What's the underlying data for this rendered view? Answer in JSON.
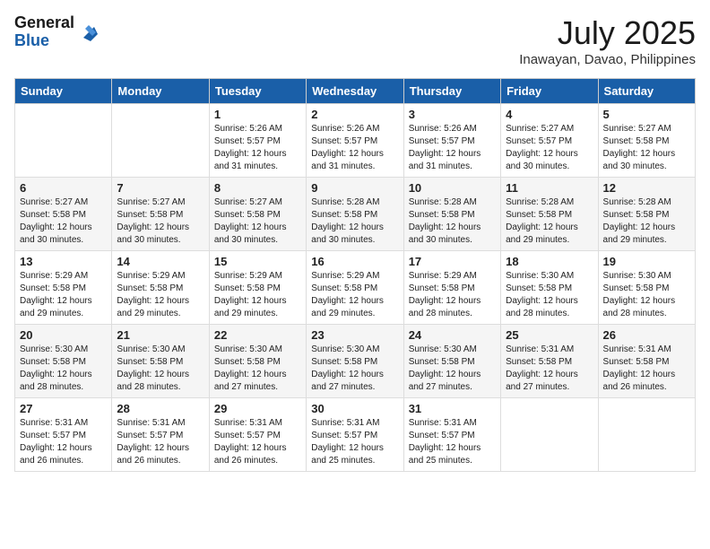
{
  "logo": {
    "general": "General",
    "blue": "Blue"
  },
  "title": "July 2025",
  "location": "Inawayan, Davao, Philippines",
  "weekdays": [
    "Sunday",
    "Monday",
    "Tuesday",
    "Wednesday",
    "Thursday",
    "Friday",
    "Saturday"
  ],
  "weeks": [
    [
      {
        "day": "",
        "info": ""
      },
      {
        "day": "",
        "info": ""
      },
      {
        "day": "1",
        "info": "Sunrise: 5:26 AM\nSunset: 5:57 PM\nDaylight: 12 hours and 31 minutes."
      },
      {
        "day": "2",
        "info": "Sunrise: 5:26 AM\nSunset: 5:57 PM\nDaylight: 12 hours and 31 minutes."
      },
      {
        "day": "3",
        "info": "Sunrise: 5:26 AM\nSunset: 5:57 PM\nDaylight: 12 hours and 31 minutes."
      },
      {
        "day": "4",
        "info": "Sunrise: 5:27 AM\nSunset: 5:57 PM\nDaylight: 12 hours and 30 minutes."
      },
      {
        "day": "5",
        "info": "Sunrise: 5:27 AM\nSunset: 5:58 PM\nDaylight: 12 hours and 30 minutes."
      }
    ],
    [
      {
        "day": "6",
        "info": "Sunrise: 5:27 AM\nSunset: 5:58 PM\nDaylight: 12 hours and 30 minutes."
      },
      {
        "day": "7",
        "info": "Sunrise: 5:27 AM\nSunset: 5:58 PM\nDaylight: 12 hours and 30 minutes."
      },
      {
        "day": "8",
        "info": "Sunrise: 5:27 AM\nSunset: 5:58 PM\nDaylight: 12 hours and 30 minutes."
      },
      {
        "day": "9",
        "info": "Sunrise: 5:28 AM\nSunset: 5:58 PM\nDaylight: 12 hours and 30 minutes."
      },
      {
        "day": "10",
        "info": "Sunrise: 5:28 AM\nSunset: 5:58 PM\nDaylight: 12 hours and 30 minutes."
      },
      {
        "day": "11",
        "info": "Sunrise: 5:28 AM\nSunset: 5:58 PM\nDaylight: 12 hours and 29 minutes."
      },
      {
        "day": "12",
        "info": "Sunrise: 5:28 AM\nSunset: 5:58 PM\nDaylight: 12 hours and 29 minutes."
      }
    ],
    [
      {
        "day": "13",
        "info": "Sunrise: 5:29 AM\nSunset: 5:58 PM\nDaylight: 12 hours and 29 minutes."
      },
      {
        "day": "14",
        "info": "Sunrise: 5:29 AM\nSunset: 5:58 PM\nDaylight: 12 hours and 29 minutes."
      },
      {
        "day": "15",
        "info": "Sunrise: 5:29 AM\nSunset: 5:58 PM\nDaylight: 12 hours and 29 minutes."
      },
      {
        "day": "16",
        "info": "Sunrise: 5:29 AM\nSunset: 5:58 PM\nDaylight: 12 hours and 29 minutes."
      },
      {
        "day": "17",
        "info": "Sunrise: 5:29 AM\nSunset: 5:58 PM\nDaylight: 12 hours and 28 minutes."
      },
      {
        "day": "18",
        "info": "Sunrise: 5:30 AM\nSunset: 5:58 PM\nDaylight: 12 hours and 28 minutes."
      },
      {
        "day": "19",
        "info": "Sunrise: 5:30 AM\nSunset: 5:58 PM\nDaylight: 12 hours and 28 minutes."
      }
    ],
    [
      {
        "day": "20",
        "info": "Sunrise: 5:30 AM\nSunset: 5:58 PM\nDaylight: 12 hours and 28 minutes."
      },
      {
        "day": "21",
        "info": "Sunrise: 5:30 AM\nSunset: 5:58 PM\nDaylight: 12 hours and 28 minutes."
      },
      {
        "day": "22",
        "info": "Sunrise: 5:30 AM\nSunset: 5:58 PM\nDaylight: 12 hours and 27 minutes."
      },
      {
        "day": "23",
        "info": "Sunrise: 5:30 AM\nSunset: 5:58 PM\nDaylight: 12 hours and 27 minutes."
      },
      {
        "day": "24",
        "info": "Sunrise: 5:30 AM\nSunset: 5:58 PM\nDaylight: 12 hours and 27 minutes."
      },
      {
        "day": "25",
        "info": "Sunrise: 5:31 AM\nSunset: 5:58 PM\nDaylight: 12 hours and 27 minutes."
      },
      {
        "day": "26",
        "info": "Sunrise: 5:31 AM\nSunset: 5:58 PM\nDaylight: 12 hours and 26 minutes."
      }
    ],
    [
      {
        "day": "27",
        "info": "Sunrise: 5:31 AM\nSunset: 5:57 PM\nDaylight: 12 hours and 26 minutes."
      },
      {
        "day": "28",
        "info": "Sunrise: 5:31 AM\nSunset: 5:57 PM\nDaylight: 12 hours and 26 minutes."
      },
      {
        "day": "29",
        "info": "Sunrise: 5:31 AM\nSunset: 5:57 PM\nDaylight: 12 hours and 26 minutes."
      },
      {
        "day": "30",
        "info": "Sunrise: 5:31 AM\nSunset: 5:57 PM\nDaylight: 12 hours and 25 minutes."
      },
      {
        "day": "31",
        "info": "Sunrise: 5:31 AM\nSunset: 5:57 PM\nDaylight: 12 hours and 25 minutes."
      },
      {
        "day": "",
        "info": ""
      },
      {
        "day": "",
        "info": ""
      }
    ]
  ]
}
